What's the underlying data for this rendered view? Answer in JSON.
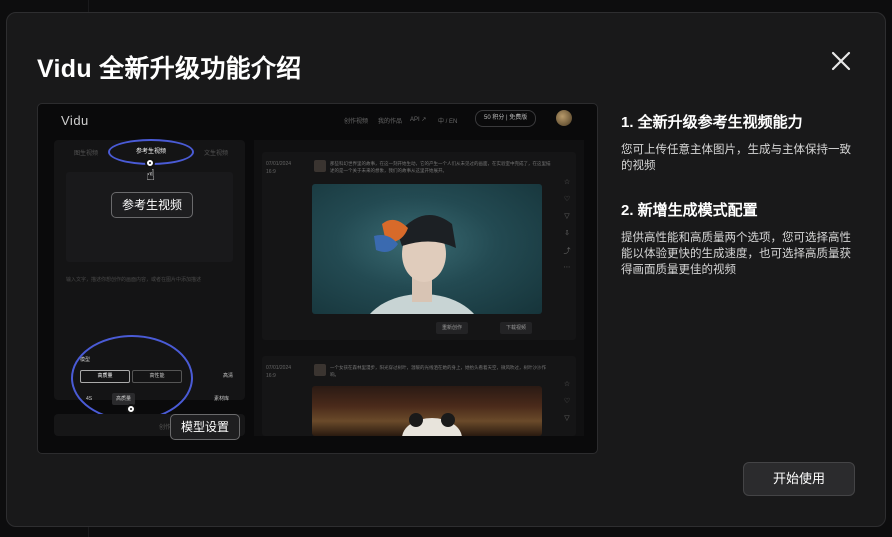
{
  "modal": {
    "title": "Vidu 全新升级功能介绍",
    "close_icon": "close-icon",
    "start_button": "开始使用"
  },
  "preview": {
    "logo": "Vidu",
    "nav": [
      "创作视频",
      "我的作品",
      "API ↗",
      "中 / EN"
    ],
    "credits": "50 积分 | 免费版",
    "tabs": [
      "图生视频",
      "参考生视频",
      "文生视频"
    ],
    "prompt_placeholder": "输入文字，描述你想创作的画面内容，或者在图片中添加描述",
    "callout_reference": "参考生视频",
    "callout_model": "模型设置",
    "model_popup": {
      "title": "模型",
      "options": [
        "高质量",
        "高性能"
      ]
    },
    "chips": {
      "duration": "4S",
      "quality": "高质量",
      "extra": "高清",
      "create": "创作",
      "library": "素材库"
    },
    "posts": [
      {
        "date": "07/01/2024",
        "ratio": "16:9",
        "text": "那些科幻世界里的故事，在这一刻开始生动，它的产生一个人们从未见过的画面，在实验室中完成了，在这里描述的是一个关于未来的想象，我们的故事从这里开始展开。",
        "actions": [
          "重新创作",
          "下载视频"
        ]
      },
      {
        "date": "07/01/2024",
        "ratio": "16:9",
        "text": "一个女孩在森林里漫步，阳光穿过树叶，温暖的光线洒在她的身上，她抬头看着天空，微风吹过，树叶沙沙作响。",
        "actions": []
      }
    ]
  },
  "features": [
    {
      "heading": "1. 全新升级参考生视频能力",
      "body": "您可上传任意主体图片，生成与主体保持一致的视频"
    },
    {
      "heading": "2. 新增生成模式配置",
      "body": "提供高性能和高质量两个选项，您可选择高性能以体验更快的生成速度，也可选择高质量获得画面质量更佳的视频"
    }
  ],
  "colors": {
    "accent_outline": "#4a5bd6",
    "modal_bg": "#19191a",
    "button_bg": "#2b2b2d"
  }
}
